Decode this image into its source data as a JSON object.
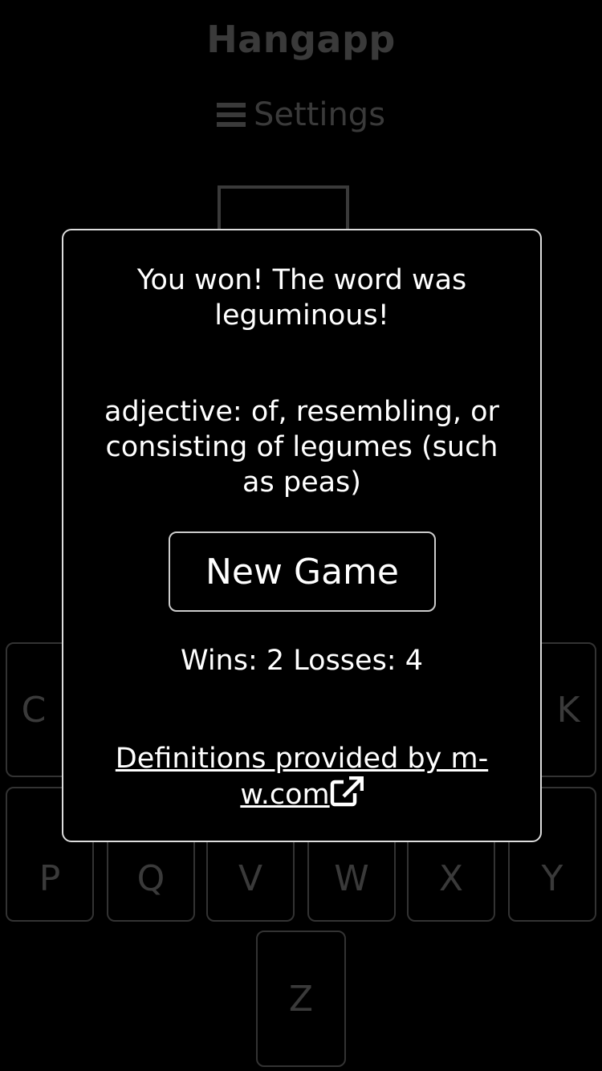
{
  "app": {
    "title": "Hangapp",
    "settings_label": "Settings"
  },
  "keyboard": {
    "row1_left": "C",
    "row1_right": "K",
    "row2": [
      "P",
      "Q",
      "V",
      "W",
      "X",
      "Y"
    ],
    "row3": [
      "Z"
    ]
  },
  "modal": {
    "result_message": "You won! The word was leguminous!",
    "definition": "adjective: of, resembling, or consisting of legumes (such as peas)",
    "new_game_label": "New Game",
    "stats": "Wins: 2 Losses: 4",
    "definitions_link": "Definitions provided by m-w.com"
  }
}
